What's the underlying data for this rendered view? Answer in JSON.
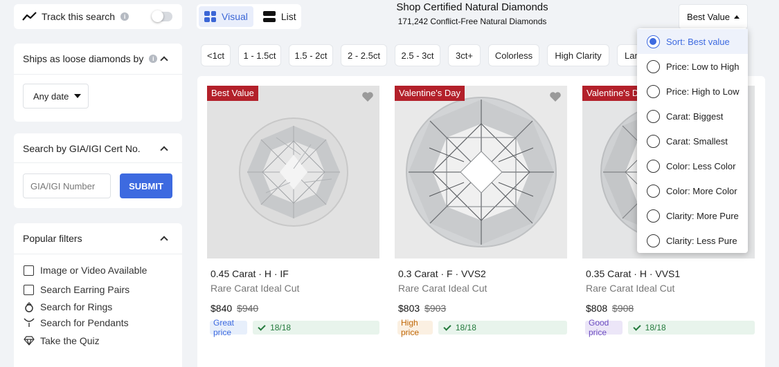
{
  "track": {
    "label": "Track this search",
    "info": "i"
  },
  "views": {
    "visual": "Visual",
    "list": "List"
  },
  "header": {
    "title": "Shop Certified Natural Diamonds",
    "subtitle": "171,242 Conflict-Free Natural Diamonds"
  },
  "sort": {
    "label": "Best Value",
    "options": [
      {
        "label": "Sort: Best value",
        "selected": true
      },
      {
        "label": "Price: Low to High"
      },
      {
        "label": "Price: High to Low"
      },
      {
        "label": "Carat: Biggest"
      },
      {
        "label": "Carat: Smallest"
      },
      {
        "label": "Color: Less Color"
      },
      {
        "label": "Color: More Color"
      },
      {
        "label": "Clarity: More Pure"
      },
      {
        "label": "Clarity: Less Pure"
      }
    ]
  },
  "ships": {
    "title": "Ships as loose diamonds by",
    "info": "i",
    "date": "Any date"
  },
  "cert": {
    "title": "Search by GIA/IGI Cert No.",
    "placeholder": "GIA/IGI Number",
    "submit": "SUBMIT"
  },
  "popular": {
    "title": "Popular filters",
    "items": [
      {
        "label": "Image or Video Available",
        "icon": "checkbox"
      },
      {
        "label": "Search Earring Pairs",
        "icon": "checkbox"
      },
      {
        "label": "Search for Rings",
        "icon": "ring-icon"
      },
      {
        "label": "Search for Pendants",
        "icon": "pendant-icon"
      },
      {
        "label": "Take the Quiz",
        "icon": "diamond-icon"
      }
    ]
  },
  "chips": [
    "<1ct",
    "1 - 1.5ct",
    "1.5 - 2ct",
    "2 - 2.5ct",
    "2.5 - 3ct",
    "3ct+",
    "Colorless",
    "High Clarity",
    "Lar"
  ],
  "products": [
    {
      "badge": "Best Value",
      "title": "0.45 Carat · H · IF",
      "sub": "Rare Carat Ideal Cut",
      "price": "$840",
      "old": "$940",
      "tag": "Great price",
      "tag_kind": "great",
      "cert": "18/18"
    },
    {
      "badge": "Valentine's Day",
      "title": "0.3 Carat · F · VVS2",
      "sub": "Rare Carat Ideal Cut",
      "price": "$803",
      "old": "$903",
      "tag": "High price",
      "tag_kind": "high",
      "cert": "18/18"
    },
    {
      "badge": "Valentine's Day",
      "title": "0.35 Carat · H · VVS1",
      "sub": "Rare Carat Ideal Cut",
      "price": "$808",
      "old": "$908",
      "tag": "Good price",
      "tag_kind": "good",
      "cert": "18/18"
    }
  ],
  "colors": {
    "accent": "#3d6ae0",
    "badge": "#b3202a"
  }
}
